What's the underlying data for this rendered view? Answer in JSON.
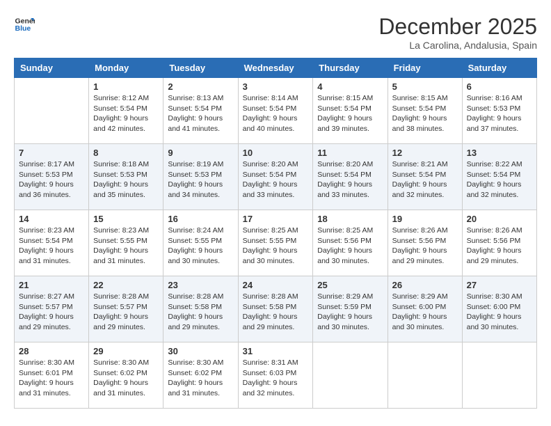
{
  "header": {
    "logo_line1": "General",
    "logo_line2": "Blue",
    "month": "December 2025",
    "location": "La Carolina, Andalusia, Spain"
  },
  "weekdays": [
    "Sunday",
    "Monday",
    "Tuesday",
    "Wednesday",
    "Thursday",
    "Friday",
    "Saturday"
  ],
  "weeks": [
    [
      {
        "day": "",
        "info": ""
      },
      {
        "day": "1",
        "info": "Sunrise: 8:12 AM\nSunset: 5:54 PM\nDaylight: 9 hours\nand 42 minutes."
      },
      {
        "day": "2",
        "info": "Sunrise: 8:13 AM\nSunset: 5:54 PM\nDaylight: 9 hours\nand 41 minutes."
      },
      {
        "day": "3",
        "info": "Sunrise: 8:14 AM\nSunset: 5:54 PM\nDaylight: 9 hours\nand 40 minutes."
      },
      {
        "day": "4",
        "info": "Sunrise: 8:15 AM\nSunset: 5:54 PM\nDaylight: 9 hours\nand 39 minutes."
      },
      {
        "day": "5",
        "info": "Sunrise: 8:15 AM\nSunset: 5:54 PM\nDaylight: 9 hours\nand 38 minutes."
      },
      {
        "day": "6",
        "info": "Sunrise: 8:16 AM\nSunset: 5:53 PM\nDaylight: 9 hours\nand 37 minutes."
      }
    ],
    [
      {
        "day": "7",
        "info": "Sunrise: 8:17 AM\nSunset: 5:53 PM\nDaylight: 9 hours\nand 36 minutes."
      },
      {
        "day": "8",
        "info": "Sunrise: 8:18 AM\nSunset: 5:53 PM\nDaylight: 9 hours\nand 35 minutes."
      },
      {
        "day": "9",
        "info": "Sunrise: 8:19 AM\nSunset: 5:53 PM\nDaylight: 9 hours\nand 34 minutes."
      },
      {
        "day": "10",
        "info": "Sunrise: 8:20 AM\nSunset: 5:54 PM\nDaylight: 9 hours\nand 33 minutes."
      },
      {
        "day": "11",
        "info": "Sunrise: 8:20 AM\nSunset: 5:54 PM\nDaylight: 9 hours\nand 33 minutes."
      },
      {
        "day": "12",
        "info": "Sunrise: 8:21 AM\nSunset: 5:54 PM\nDaylight: 9 hours\nand 32 minutes."
      },
      {
        "day": "13",
        "info": "Sunrise: 8:22 AM\nSunset: 5:54 PM\nDaylight: 9 hours\nand 32 minutes."
      }
    ],
    [
      {
        "day": "14",
        "info": "Sunrise: 8:23 AM\nSunset: 5:54 PM\nDaylight: 9 hours\nand 31 minutes."
      },
      {
        "day": "15",
        "info": "Sunrise: 8:23 AM\nSunset: 5:55 PM\nDaylight: 9 hours\nand 31 minutes."
      },
      {
        "day": "16",
        "info": "Sunrise: 8:24 AM\nSunset: 5:55 PM\nDaylight: 9 hours\nand 30 minutes."
      },
      {
        "day": "17",
        "info": "Sunrise: 8:25 AM\nSunset: 5:55 PM\nDaylight: 9 hours\nand 30 minutes."
      },
      {
        "day": "18",
        "info": "Sunrise: 8:25 AM\nSunset: 5:56 PM\nDaylight: 9 hours\nand 30 minutes."
      },
      {
        "day": "19",
        "info": "Sunrise: 8:26 AM\nSunset: 5:56 PM\nDaylight: 9 hours\nand 29 minutes."
      },
      {
        "day": "20",
        "info": "Sunrise: 8:26 AM\nSunset: 5:56 PM\nDaylight: 9 hours\nand 29 minutes."
      }
    ],
    [
      {
        "day": "21",
        "info": "Sunrise: 8:27 AM\nSunset: 5:57 PM\nDaylight: 9 hours\nand 29 minutes."
      },
      {
        "day": "22",
        "info": "Sunrise: 8:28 AM\nSunset: 5:57 PM\nDaylight: 9 hours\nand 29 minutes."
      },
      {
        "day": "23",
        "info": "Sunrise: 8:28 AM\nSunset: 5:58 PM\nDaylight: 9 hours\nand 29 minutes."
      },
      {
        "day": "24",
        "info": "Sunrise: 8:28 AM\nSunset: 5:58 PM\nDaylight: 9 hours\nand 29 minutes."
      },
      {
        "day": "25",
        "info": "Sunrise: 8:29 AM\nSunset: 5:59 PM\nDaylight: 9 hours\nand 30 minutes."
      },
      {
        "day": "26",
        "info": "Sunrise: 8:29 AM\nSunset: 6:00 PM\nDaylight: 9 hours\nand 30 minutes."
      },
      {
        "day": "27",
        "info": "Sunrise: 8:30 AM\nSunset: 6:00 PM\nDaylight: 9 hours\nand 30 minutes."
      }
    ],
    [
      {
        "day": "28",
        "info": "Sunrise: 8:30 AM\nSunset: 6:01 PM\nDaylight: 9 hours\nand 31 minutes."
      },
      {
        "day": "29",
        "info": "Sunrise: 8:30 AM\nSunset: 6:02 PM\nDaylight: 9 hours\nand 31 minutes."
      },
      {
        "day": "30",
        "info": "Sunrise: 8:30 AM\nSunset: 6:02 PM\nDaylight: 9 hours\nand 31 minutes."
      },
      {
        "day": "31",
        "info": "Sunrise: 8:31 AM\nSunset: 6:03 PM\nDaylight: 9 hours\nand 32 minutes."
      },
      {
        "day": "",
        "info": ""
      },
      {
        "day": "",
        "info": ""
      },
      {
        "day": "",
        "info": ""
      }
    ]
  ]
}
